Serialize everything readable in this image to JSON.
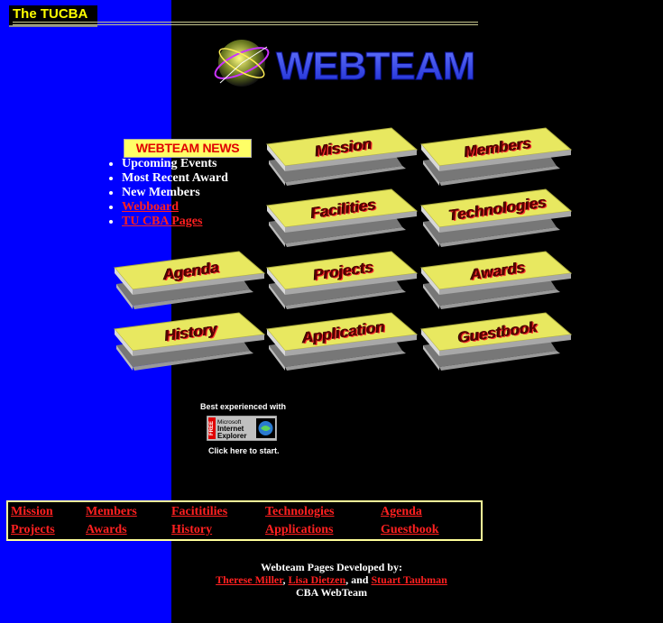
{
  "header": {
    "brand": "The TUCBA",
    "logo_text": "WEBTEAM"
  },
  "news": {
    "title": "WEBTEAM NEWS",
    "items": [
      {
        "label": "Upcoming Events",
        "link": false
      },
      {
        "label": "Most Recent Award",
        "link": false
      },
      {
        "label": "New Members",
        "link": false
      },
      {
        "label": "Webboard",
        "link": true
      },
      {
        "label": "TU CBA Pages",
        "link": true
      }
    ]
  },
  "tiles": [
    {
      "label": "Mission"
    },
    {
      "label": "Members"
    },
    {
      "label": "Facilities"
    },
    {
      "label": "Technologies"
    },
    {
      "label": "Agenda"
    },
    {
      "label": "Projects"
    },
    {
      "label": "Awards"
    },
    {
      "label": "History"
    },
    {
      "label": "Application"
    },
    {
      "label": "Guestbook"
    }
  ],
  "browser_note": {
    "best_text": "Best experienced with",
    "badge_line1": "Microsoft",
    "badge_line2": "Internet",
    "badge_line3": "Explorer",
    "badge_side": "FREE",
    "start_text": "Click here to start."
  },
  "nav_links": [
    "Mission",
    "Members",
    "Facititilies",
    "Technologies",
    "Agenda",
    "Projects",
    "Awards",
    "History",
    "Applications",
    "Guestbook"
  ],
  "credits": {
    "line1": "Webteam Pages Developed by:",
    "author1": "Therese Miller",
    "sep1": ", ",
    "author2": "Lisa Dietzen",
    "sep2": ", and ",
    "author3": "Stuart Taubman",
    "line3": "CBA WebTeam"
  },
  "colors": {
    "left_stripe": "#0000ff",
    "background": "#000000",
    "link": "#ff2020",
    "tile_face": "#e8e860",
    "news_badge": "#ffff66"
  }
}
